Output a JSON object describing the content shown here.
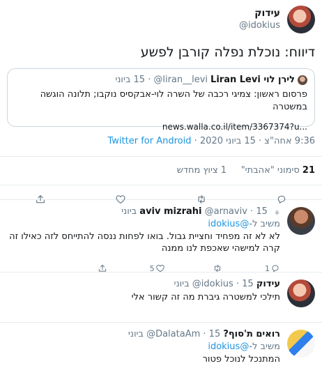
{
  "main_tweet": {
    "display_name": "עידוק",
    "handle": "@idokius",
    "text": "דיווח: נוכלת נפלה קורבן לפשע",
    "quote": {
      "name": "לירן לוי Liran Levi",
      "handle": "@liran__levi",
      "date": "15 ביוני",
      "text": "פרסום ראשון: צמיגי רכבה של השרה לוי-אבקסיס נוקבו; תלונה הוגשה במשטרה",
      "link": "news.walla.co.il/item/3367374?u..."
    },
    "meta": {
      "time_date": "9:36 אחה\"צ · 15 ביוני 2020 · ",
      "source": "Twitter for Android"
    },
    "stats": {
      "likes_count": "21",
      "likes_label": "סימוני \"אהבתי\"",
      "retweets_label": "1 ציוץ מחדש"
    }
  },
  "replies": [
    {
      "display_name": "aviv mizrahi",
      "handle": "@arnaviv",
      "date": "15 ביוני",
      "reply_prefix": "משיב ל-",
      "reply_to": "@idokius",
      "text": "לא לא זה מפחיד וחציית גבול. בואו לפחות ננסה להתייחס לזה כאילו זה קרה למישהי שאכפת לנו ממנה",
      "reply_count": "1",
      "retweet_count": "",
      "like_count": "5"
    },
    {
      "display_name": "עידוק",
      "handle": "@idokius",
      "date": "15 ביוני",
      "reply_prefix": "",
      "reply_to": "",
      "text": "תילכי למשטרה גיברת מה זה קשור אלי",
      "reply_count": "",
      "retweet_count": "",
      "like_count": ""
    },
    {
      "display_name": "רואים ת'סוף?",
      "handle": "@DalataAm",
      "date": "15 ביוני",
      "reply_prefix": "משיב ל-",
      "reply_to": "@idokius",
      "text": "המתנכל לנוכל פטור",
      "reply_count": "",
      "retweet_count": "",
      "like_count": ""
    }
  ],
  "icons": {
    "reply": "reply-icon",
    "retweet": "retweet-icon",
    "like": "heart-icon",
    "share": "share-icon"
  },
  "colors": {
    "accent": "#1b95e0",
    "muted": "#657786",
    "border": "#e6ecf0"
  }
}
